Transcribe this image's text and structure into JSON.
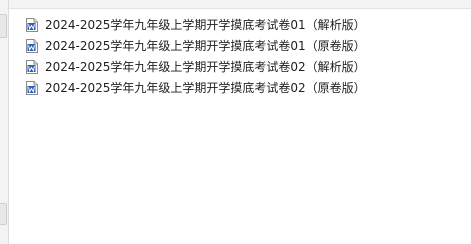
{
  "files": [
    {
      "name": "2024-2025学年九年级上学期开学摸底考试卷01（解析版）",
      "icon": "word-doc-icon"
    },
    {
      "name": "2024-2025学年九年级上学期开学摸底考试卷01（原卷版）",
      "icon": "word-doc-icon"
    },
    {
      "name": "2024-2025学年九年级上学期开学摸底考试卷02（解析版）",
      "icon": "word-doc-icon"
    },
    {
      "name": "2024-2025学年九年级上学期开学摸底考试卷02（原卷版）",
      "icon": "word-doc-icon"
    }
  ],
  "colors": {
    "word_blue": "#2b5fb4",
    "text": "#1f1f1f",
    "background": "#ffffff"
  }
}
